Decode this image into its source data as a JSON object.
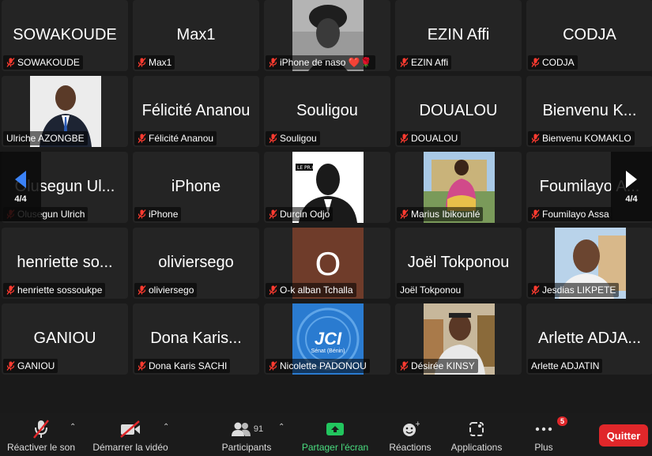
{
  "participants": [
    {
      "big": "SOWAKOUDE",
      "label": "SOWAKOUDE",
      "muted": true,
      "photo": null
    },
    {
      "big": "Max1",
      "label": "Max1",
      "muted": true,
      "photo": null
    },
    {
      "big": "",
      "label": "iPhone de naso ❤️🌹",
      "muted": true,
      "photo": "woman-headwrap"
    },
    {
      "big": "EZIN Affi",
      "label": "EZIN Affi",
      "muted": true,
      "photo": null
    },
    {
      "big": "CODJA",
      "label": "CODJA",
      "muted": true,
      "photo": null
    },
    {
      "big": "",
      "label": "Ulriche AZONGBE",
      "muted": false,
      "photo": "man-suit"
    },
    {
      "big": "Félicité Ananou",
      "label": "Félicité Ananou",
      "muted": true,
      "photo": null
    },
    {
      "big": "Souligou",
      "label": "Souligou",
      "muted": true,
      "photo": null
    },
    {
      "big": "DOUALOU",
      "label": "DOUALOU",
      "muted": true,
      "photo": null
    },
    {
      "big": "Bienvenu K...",
      "label": "Bienvenu KOMAKLO",
      "muted": true,
      "photo": null
    },
    {
      "big": "Olusegun Ul...",
      "label": "Olusegun Ulrich",
      "muted": true,
      "photo": null
    },
    {
      "big": "iPhone",
      "label": "iPhone",
      "muted": true,
      "photo": null
    },
    {
      "big": "",
      "label": "Durcin Odjo",
      "muted": true,
      "photo": "silhouette"
    },
    {
      "big": "",
      "label": "Marius Ibikounlé",
      "muted": true,
      "photo": "person-outdoor"
    },
    {
      "big": "Foumilayo A...",
      "label": "Foumilayo Assa",
      "muted": true,
      "photo": null
    },
    {
      "big": "henriette so...",
      "label": "henriette sossoukpe",
      "muted": true,
      "photo": null
    },
    {
      "big": "oliviersego",
      "label": "oliviersego",
      "muted": true,
      "photo": null
    },
    {
      "big": "O",
      "label": "O-k alban Tchalla",
      "muted": true,
      "photo": "letter-avatar"
    },
    {
      "big": "Joël Tokponou",
      "label": "Joël Tokponou",
      "muted": false,
      "photo": null
    },
    {
      "big": "",
      "label": "Jesdias LIKPETE",
      "muted": true,
      "photo": "man-outdoor"
    },
    {
      "big": "GANIOU",
      "label": "GANIOU",
      "muted": true,
      "photo": null
    },
    {
      "big": "Dona Karis...",
      "label": "Dona Karis SACHI",
      "muted": true,
      "photo": null
    },
    {
      "big": "",
      "label": "Nicolette PADONOU",
      "muted": true,
      "photo": "jci-logo"
    },
    {
      "big": "",
      "label": "Désirée KINSY",
      "muted": true,
      "photo": "woman-selfie"
    },
    {
      "big": "Arlette ADJA...",
      "label": "Arlette ADJATIN",
      "muted": false,
      "photo": null
    }
  ],
  "jci_logo_text": "JCI",
  "jci_logo_sub": "Sénat (Bénin)",
  "silhouette_tag": "LE PR.G",
  "pagination": {
    "left": "4/4",
    "right": "4/4"
  },
  "toolbar": {
    "unmute": "Réactiver le son",
    "start_video": "Démarrer la vidéo",
    "participants": "Participants",
    "participants_count": "91",
    "share": "Partager l'écran",
    "reactions": "Réactions",
    "apps": "Applications",
    "more": "Plus",
    "more_badge": "5",
    "quit": "Quitter"
  },
  "colors": {
    "tile": "#242424",
    "muted": "#e0272a",
    "share": "#22c55e",
    "quit": "#e0272a"
  }
}
